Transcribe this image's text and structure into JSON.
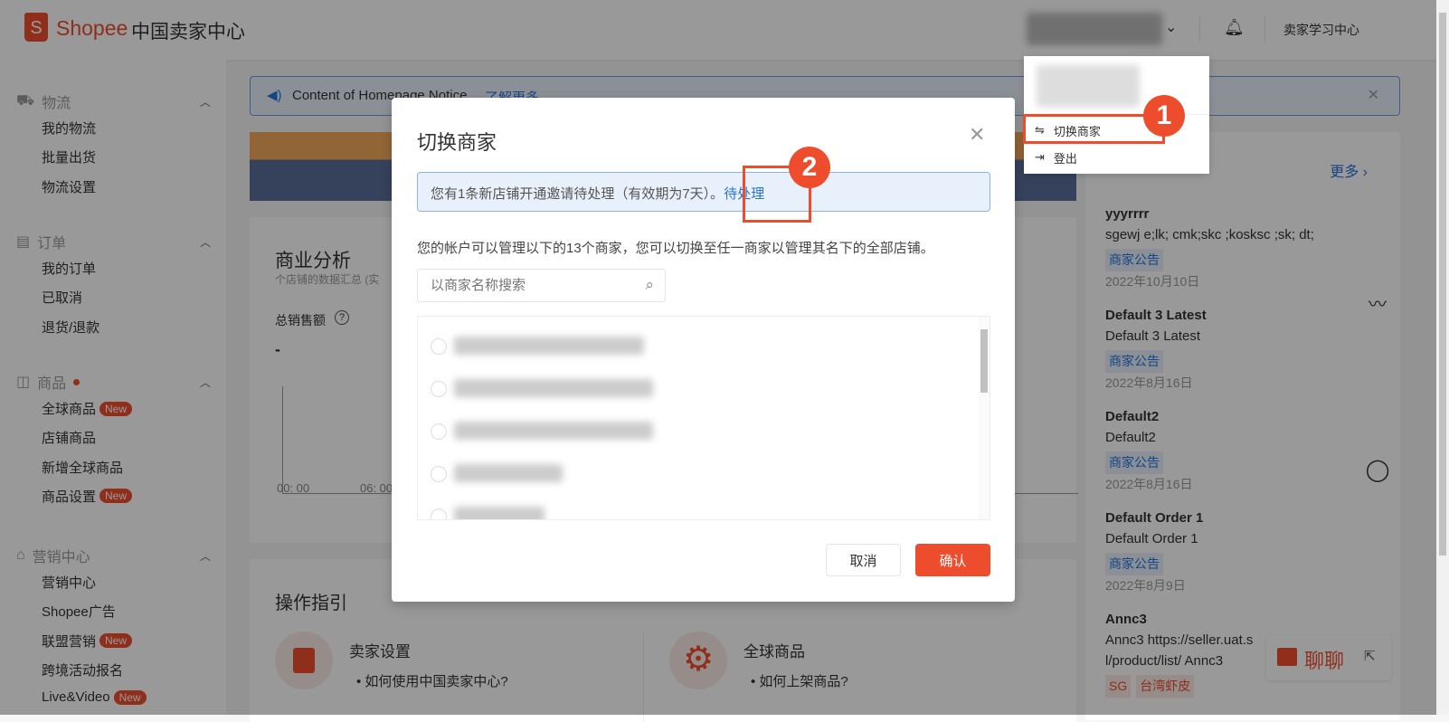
{
  "header": {
    "brand": "Shopee",
    "title": "中国卖家中心",
    "learning_center": "卖家学习中心",
    "icons": [
      "shopee-bag-icon",
      "chevron-down-icon",
      "bell-icon"
    ]
  },
  "sidebar": {
    "sections": [
      {
        "label": "物流",
        "icon": "truck-icon",
        "items": [
          {
            "label": "我的物流"
          },
          {
            "label": "批量出货"
          },
          {
            "label": "物流设置"
          }
        ]
      },
      {
        "label": "订单",
        "icon": "clipboard-icon",
        "items": [
          {
            "label": "我的订单"
          },
          {
            "label": "已取消"
          },
          {
            "label": "退货/退款"
          }
        ]
      },
      {
        "label": "商品",
        "icon": "bag-icon",
        "dot": true,
        "items": [
          {
            "label": "全球商品",
            "badge": "New"
          },
          {
            "label": "店铺商品"
          },
          {
            "label": "新增全球商品"
          },
          {
            "label": "商品设置",
            "badge": "New"
          }
        ]
      },
      {
        "label": "营销中心",
        "icon": "tag-icon",
        "items": [
          {
            "label": "营销中心"
          },
          {
            "label": "Shopee广告"
          },
          {
            "label": "联盟营销",
            "badge": "New"
          },
          {
            "label": "跨境活动报名"
          },
          {
            "label": "Live&Video",
            "badge": "New"
          }
        ]
      }
    ]
  },
  "notice": {
    "text": "Content of Homepage Notice",
    "link": "了解更多"
  },
  "analysis": {
    "title": "商业分析",
    "subtitle": "个店铺的数据汇总 (实",
    "metric": "总销售额",
    "value": "-",
    "x_ticks": [
      "00: 00",
      "06: 00"
    ]
  },
  "guide": {
    "title": "操作指引",
    "cards": [
      {
        "title": "卖家设置",
        "items": [
          "如何使用中国卖家中心?"
        ]
      },
      {
        "title": "全球商品",
        "items": [
          "如何上架商品?"
        ]
      }
    ]
  },
  "announcements": {
    "more": "更多",
    "items": [
      {
        "title": "yyyrrrr",
        "body": "sgewj e;lk; cmk;skc ;kosksc ;sk; dt;",
        "tags": [
          "商家公告"
        ],
        "date": "2022年10月10日"
      },
      {
        "title": "Default 3 Latest",
        "body": "Default 3 Latest",
        "tags": [
          "商家公告"
        ],
        "date": "2022年8月16日"
      },
      {
        "title": "Default2",
        "body": "Default2",
        "tags": [
          "商家公告"
        ],
        "date": "2022年8月16日"
      },
      {
        "title": "Default Order 1",
        "body": "Default Order 1",
        "tags": [
          "商家公告"
        ],
        "date": "2022年8月9日"
      },
      {
        "title": "Annc3",
        "body": "Annc3 https://seller.uat.s",
        "body2": "l/product/list/ Annc3",
        "tags": [
          "SG",
          "台湾虾皮"
        ]
      }
    ]
  },
  "chat": {
    "label": "聊聊"
  },
  "dropdown": {
    "items": [
      {
        "label": "切换商家",
        "icon": "switch-icon"
      },
      {
        "label": "登出",
        "icon": "logout-icon"
      }
    ]
  },
  "modal": {
    "title": "切换商家",
    "invite_text": "您有1条新店铺开通邀请待处理（有效期为7天）。",
    "invite_link": "待处理",
    "description": "您的帐户可以管理以下的13个商家，您可以切换至任一商家以管理其名下的全部店铺。",
    "search_placeholder": "以商家名称搜索",
    "cancel": "取消",
    "confirm": "确认"
  },
  "annotations": [
    "1",
    "2"
  ],
  "colors": {
    "brand": "#ee4d2d",
    "link": "#2673dd",
    "info_bg": "#e8f0fb"
  }
}
